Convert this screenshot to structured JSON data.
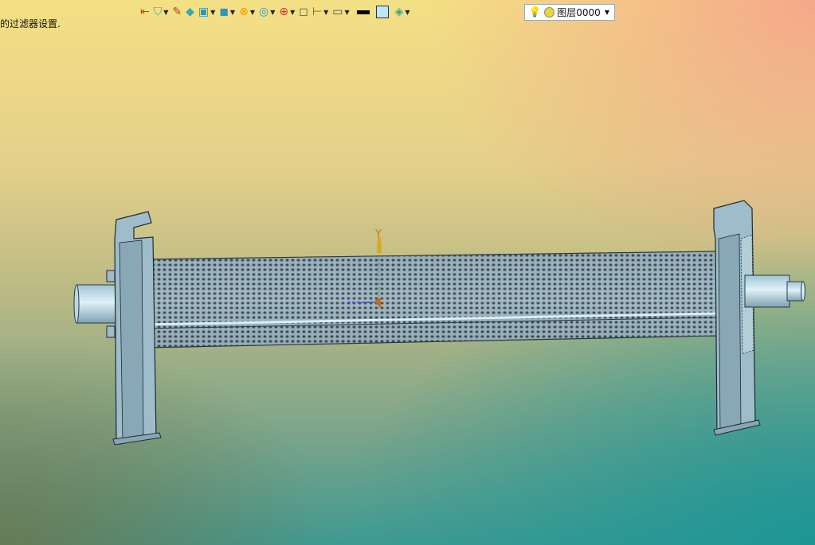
{
  "status_text": "的过滤器设置.",
  "toolbar": {
    "tools": [
      {
        "name": "exit-sketch-icon",
        "glyph": "⇤",
        "color": "#d33"
      },
      {
        "name": "filter-icon",
        "glyph": "⛉",
        "color": "#3a8"
      },
      {
        "name": "pen-icon",
        "glyph": "✎",
        "color": "#c33"
      },
      {
        "name": "box-icon",
        "glyph": "◆",
        "color": "#3ab"
      },
      {
        "name": "cube-icon",
        "glyph": "▣",
        "color": "#29c"
      },
      {
        "name": "view-cube-icon",
        "glyph": "◼",
        "color": "#29c"
      },
      {
        "name": "sphere-icon",
        "glyph": "⊗",
        "color": "#e90"
      },
      {
        "name": "render-icon",
        "glyph": "◎",
        "color": "#29c"
      },
      {
        "name": "target-icon",
        "glyph": "⊕",
        "color": "#c33"
      },
      {
        "name": "frame-icon",
        "glyph": "◻",
        "color": "#555"
      },
      {
        "name": "dimension-icon",
        "glyph": "⊢",
        "color": "#c33"
      },
      {
        "name": "monitor-icon",
        "glyph": "▭",
        "color": "#445"
      }
    ],
    "layer_label": "图层0000"
  },
  "viewport": {
    "axis_label": "Y"
  }
}
